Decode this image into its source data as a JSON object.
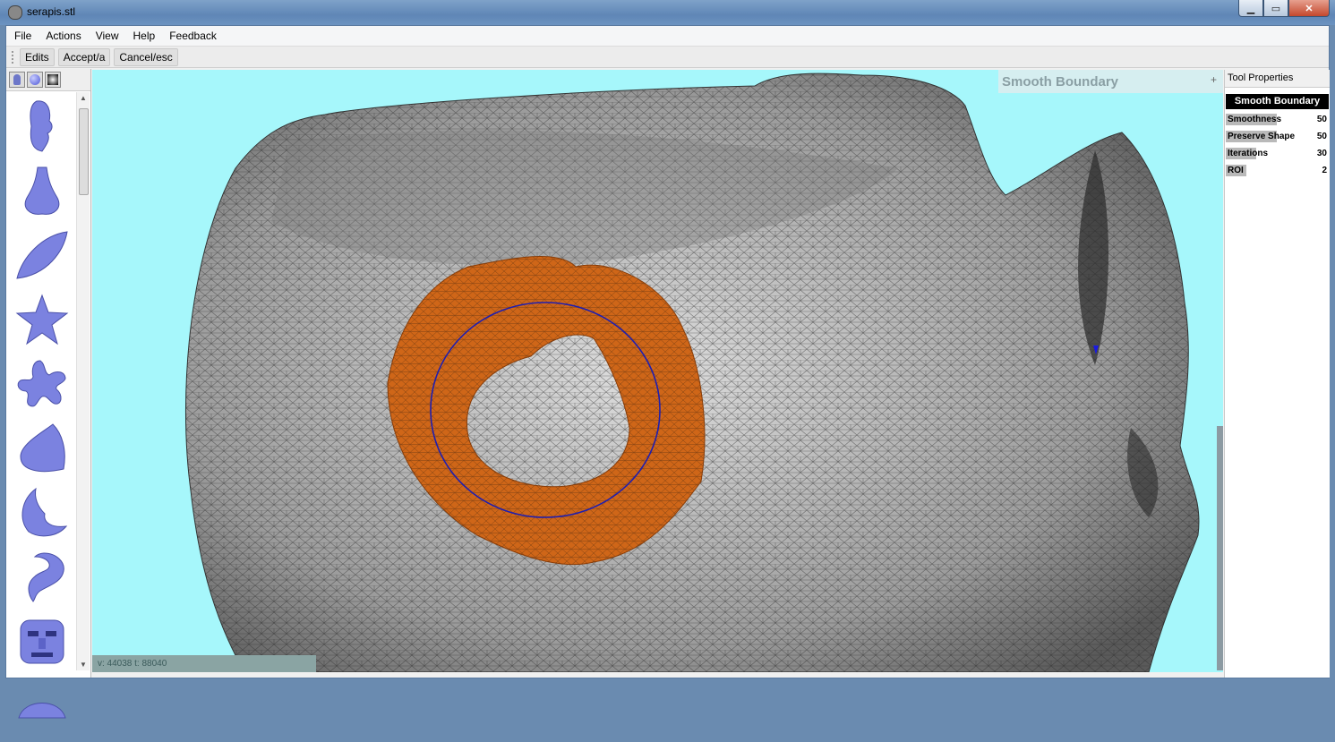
{
  "window": {
    "title": "serapis.stl"
  },
  "menu": [
    "File",
    "Actions",
    "View",
    "Help",
    "Feedback"
  ],
  "toolbar": [
    "Edits",
    "Accept/a",
    "Cancel/esc"
  ],
  "viewport": {
    "tool_title": "Smooth Boundary",
    "tool_expand": "+",
    "status": "v: 44038 t: 88040"
  },
  "properties": {
    "panel_title": "Tool Properties",
    "tool_name": "Smooth Boundary",
    "params": [
      {
        "label": "Smoothness",
        "value": "50",
        "fill": 0.5
      },
      {
        "label": "Preserve Shape",
        "value": "50",
        "fill": 0.5
      },
      {
        "label": "Iterations",
        "value": "30",
        "fill": 0.3
      },
      {
        "label": "ROI",
        "value": "2",
        "fill": 0.2
      }
    ]
  },
  "palette": {
    "tab_icons": [
      "head-icon",
      "sphere-icon",
      "gradient-icon"
    ],
    "shapes": [
      "face",
      "nose",
      "leaf",
      "star",
      "splat",
      "half-dome",
      "crescent",
      "hook",
      "mask",
      "dome"
    ]
  },
  "colors": {
    "viewport_bg": "#a6f7fb",
    "selection": "#d0661a",
    "brush": "#1e1eb0",
    "shape": "#7b82e0"
  }
}
